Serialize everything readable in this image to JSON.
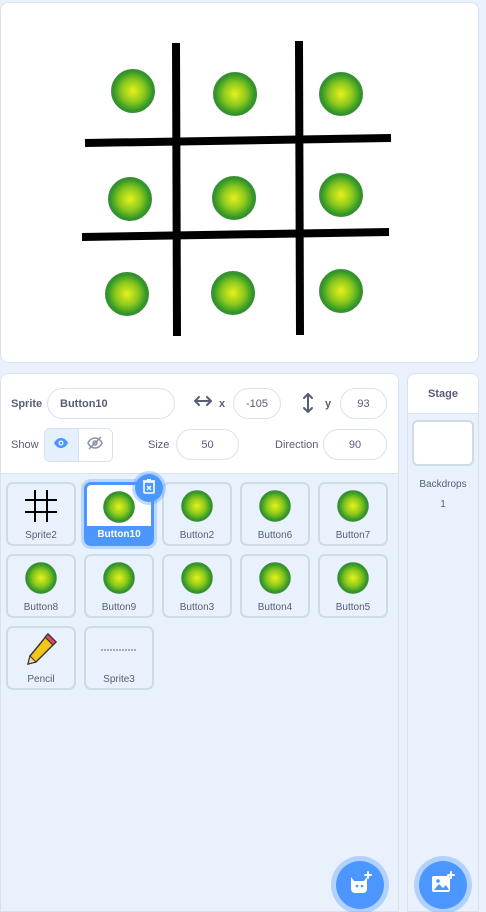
{
  "sprite_info": {
    "sprite_label": "Sprite",
    "sprite_name": "Button10",
    "x_label": "x",
    "x_value": "-105",
    "y_label": "y",
    "y_value": "93",
    "show_label": "Show",
    "size_label": "Size",
    "size_value": "50",
    "direction_label": "Direction",
    "direction_value": "90",
    "visible": true
  },
  "sprites": [
    {
      "name": "Sprite2",
      "thumb": "grid-icon",
      "selected": false
    },
    {
      "name": "Button10",
      "thumb": "green-button",
      "selected": true
    },
    {
      "name": "Button2",
      "thumb": "green-button",
      "selected": false
    },
    {
      "name": "Button6",
      "thumb": "green-button",
      "selected": false
    },
    {
      "name": "Button7",
      "thumb": "green-button",
      "selected": false
    },
    {
      "name": "Button8",
      "thumb": "green-button",
      "selected": false
    },
    {
      "name": "Button9",
      "thumb": "green-button",
      "selected": false
    },
    {
      "name": "Button3",
      "thumb": "green-button",
      "selected": false
    },
    {
      "name": "Button4",
      "thumb": "green-button",
      "selected": false
    },
    {
      "name": "Button5",
      "thumb": "green-button",
      "selected": false
    },
    {
      "name": "Pencil",
      "thumb": "pencil-icon",
      "selected": false
    },
    {
      "name": "Sprite3",
      "thumb": "line-icon",
      "selected": false
    }
  ],
  "stage_panel": {
    "title": "Stage",
    "backdrops_label": "Backdrops",
    "backdrops_count": "1"
  },
  "icons": {
    "x_axis": "horizontal-arrows-icon",
    "y_axis": "vertical-arrows-icon",
    "show": "eye-icon",
    "hide": "eye-slash-icon",
    "delete": "trash-icon",
    "choose_sprite": "cat-plus-icon",
    "choose_backdrop": "image-plus-icon"
  },
  "colors": {
    "accent": "#4c97ff",
    "panel_bg": "#e9f1fc",
    "button_green_dark": "#2f9a2a",
    "button_green_light": "#e6f21a"
  }
}
